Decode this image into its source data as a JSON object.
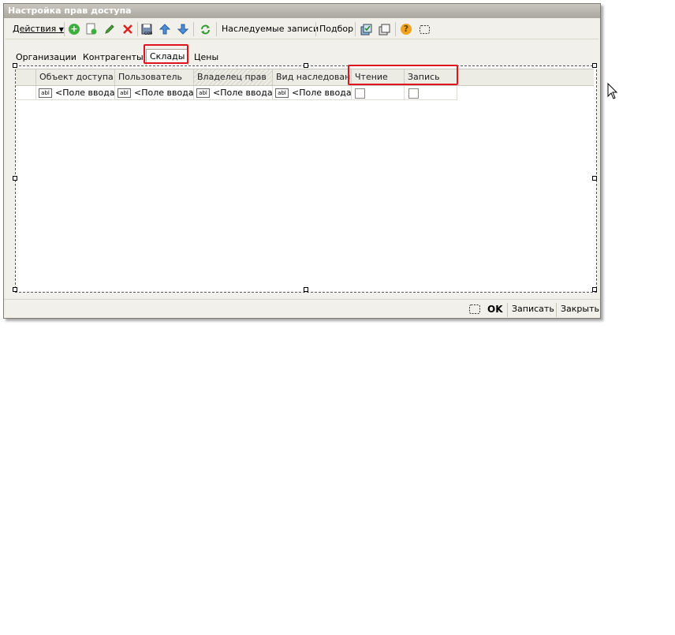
{
  "window": {
    "title": "Настройка прав доступа"
  },
  "toolbar": {
    "actions_label": "Действия",
    "icons": [
      "add-icon",
      "copy-icon",
      "edit-icon",
      "delete-icon",
      "save-copy-icon",
      "move-up-icon",
      "move-down-icon",
      "refresh-icon"
    ],
    "inherited_label": "Наследуемые записи",
    "selection_label": "Подбор",
    "help_icon": "help-icon"
  },
  "tabs": [
    {
      "label": "Организации",
      "active": false
    },
    {
      "label": "Контрагенты",
      "active": false
    },
    {
      "label": "Склады",
      "active": true
    },
    {
      "label": "Цены",
      "active": false
    }
  ],
  "table": {
    "columns": [
      "Объект доступа",
      "Пользователь",
      "Владелец прав",
      "Вид наследован...",
      "Чтение",
      "Запись"
    ],
    "row": {
      "field_icon": "abl",
      "cells": [
        "<Поле ввода>",
        "<Поле ввода>",
        "<Поле ввода>",
        "<Поле ввода>"
      ]
    }
  },
  "footer": {
    "ok_label": "OK",
    "save_label": "Записать",
    "close_label": "Закрыть"
  },
  "colors": {
    "highlight": "#e0141e",
    "window_bg": "#f2f0ea"
  }
}
